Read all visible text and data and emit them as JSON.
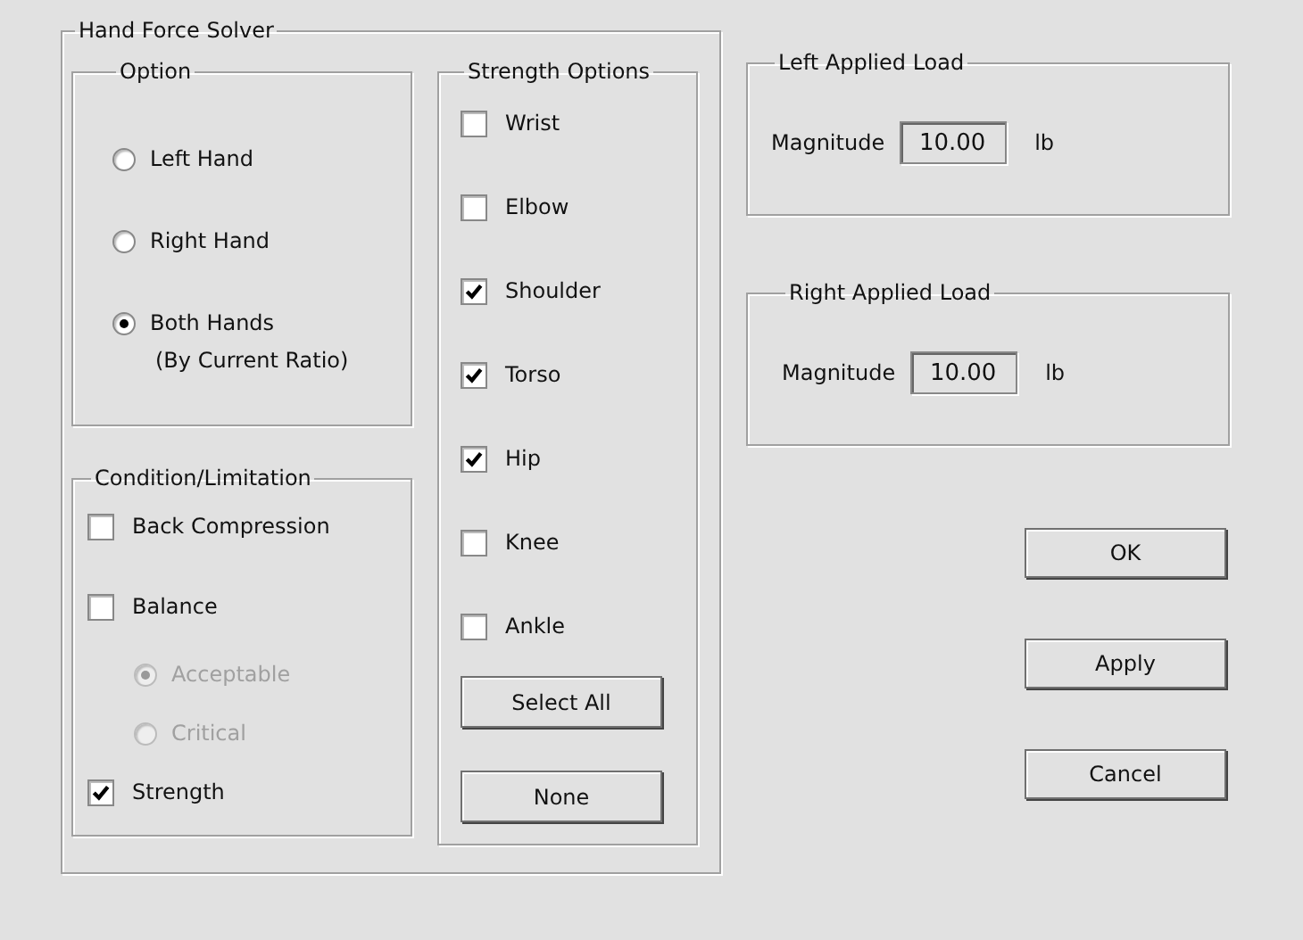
{
  "solver": {
    "title": "Hand Force Solver"
  },
  "option": {
    "title": "Option",
    "choices": [
      {
        "label": "Left Hand",
        "selected": false
      },
      {
        "label": "Right Hand",
        "selected": false
      },
      {
        "label": "Both Hands",
        "note": "(By Current Ratio)",
        "selected": true
      }
    ]
  },
  "condition": {
    "title": "Condition/Limitation",
    "items": [
      {
        "kind": "checkbox",
        "label": "Back Compression",
        "checked": false,
        "disabled": false
      },
      {
        "kind": "checkbox",
        "label": "Balance",
        "checked": false,
        "disabled": false
      },
      {
        "kind": "radio",
        "label": "Acceptable",
        "selected": true,
        "disabled": true
      },
      {
        "kind": "radio",
        "label": "Critical",
        "selected": false,
        "disabled": true
      },
      {
        "kind": "checkbox",
        "label": "Strength",
        "checked": true,
        "disabled": false
      }
    ]
  },
  "strength": {
    "title": "Strength Options",
    "items": [
      {
        "label": "Wrist",
        "checked": false
      },
      {
        "label": "Elbow",
        "checked": false
      },
      {
        "label": "Shoulder",
        "checked": true
      },
      {
        "label": "Torso",
        "checked": true
      },
      {
        "label": "Hip",
        "checked": true
      },
      {
        "label": "Knee",
        "checked": false
      },
      {
        "label": "Ankle",
        "checked": false
      }
    ],
    "buttons": [
      "Select All",
      "None"
    ]
  },
  "loads": [
    {
      "title": "Left Applied Load",
      "label": "Magnitude",
      "value": "10.00",
      "unit": "lb"
    },
    {
      "title": "Right Applied Load",
      "label": "Magnitude",
      "value": "10.00",
      "unit": "lb"
    }
  ],
  "buttons": [
    "OK",
    "Apply",
    "Cancel"
  ]
}
